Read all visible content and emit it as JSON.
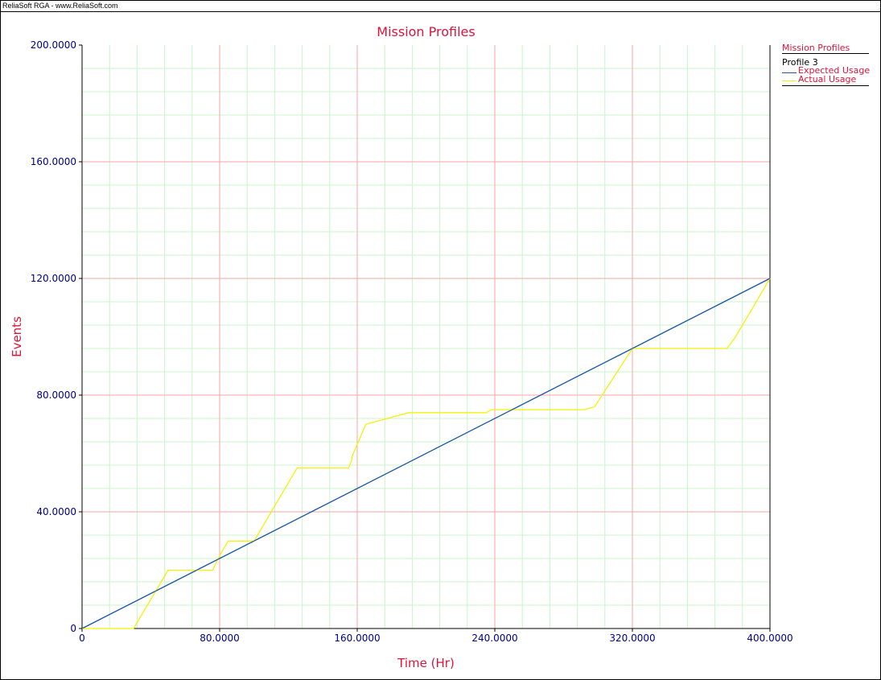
{
  "window": {
    "title": "ReliaSoft RGA - www.ReliaSoft.com"
  },
  "legend": {
    "title": "Mission Profiles",
    "profile": "Profile 3",
    "entries": [
      "Expected Usage",
      "Actual Usage"
    ]
  },
  "colors": {
    "title": "#dc143c",
    "tick_labels": "#000080",
    "grid_major": "#f4a6a6",
    "grid_minor": "#c9f5c9",
    "expected": "#1f5aa8",
    "actual": "#f2f20a"
  },
  "chart_data": {
    "type": "line",
    "title": "Mission Profiles",
    "xlabel": "Time (Hr)",
    "ylabel": "Events",
    "xlim": [
      0,
      400
    ],
    "ylim": [
      0,
      200
    ],
    "x_ticks": [
      "0",
      "80.0000",
      "160.0000",
      "240.0000",
      "320.0000",
      "400.0000"
    ],
    "y_ticks": [
      "0",
      "40.0000",
      "80.0000",
      "120.0000",
      "160.0000",
      "200.0000"
    ],
    "grid": true,
    "legend_position": "top-right",
    "series": [
      {
        "name": "Expected Usage",
        "points": [
          [
            0,
            0
          ],
          [
            400,
            120
          ]
        ]
      },
      {
        "name": "Actual Usage",
        "points": [
          [
            0,
            0
          ],
          [
            30,
            0
          ],
          [
            50,
            20
          ],
          [
            76,
            20
          ],
          [
            80,
            25
          ],
          [
            85,
            30
          ],
          [
            100,
            30
          ],
          [
            125,
            55
          ],
          [
            155,
            55
          ],
          [
            157,
            58
          ],
          [
            157,
            59
          ],
          [
            165,
            70
          ],
          [
            190,
            74
          ],
          [
            235,
            74
          ],
          [
            238,
            75
          ],
          [
            292,
            75
          ],
          [
            298,
            76
          ],
          [
            320,
            96
          ],
          [
            375,
            96
          ],
          [
            380,
            100
          ],
          [
            400,
            120
          ]
        ]
      }
    ]
  }
}
